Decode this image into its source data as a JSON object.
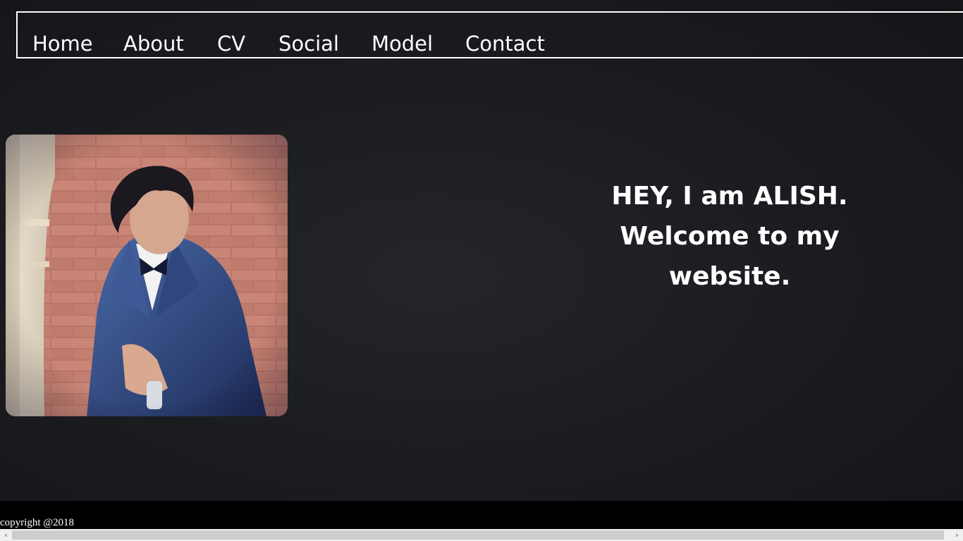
{
  "nav": {
    "items": [
      {
        "label": "Home"
      },
      {
        "label": "About"
      },
      {
        "label": "CV"
      },
      {
        "label": "Social"
      },
      {
        "label": "Model"
      },
      {
        "label": "Contact"
      }
    ]
  },
  "hero": {
    "headline_lines": [
      "HEY, I am ALISH.",
      "Welcome to my",
      "website."
    ],
    "photo_icon": "portrait-photo"
  },
  "footer": {
    "copyright": "copyright @2018"
  },
  "scrollbar": {
    "left_arrow": "‹",
    "right_arrow": "›"
  },
  "colors": {
    "background": "#1b1d21",
    "text": "#ffffff",
    "footer": "#000000"
  }
}
